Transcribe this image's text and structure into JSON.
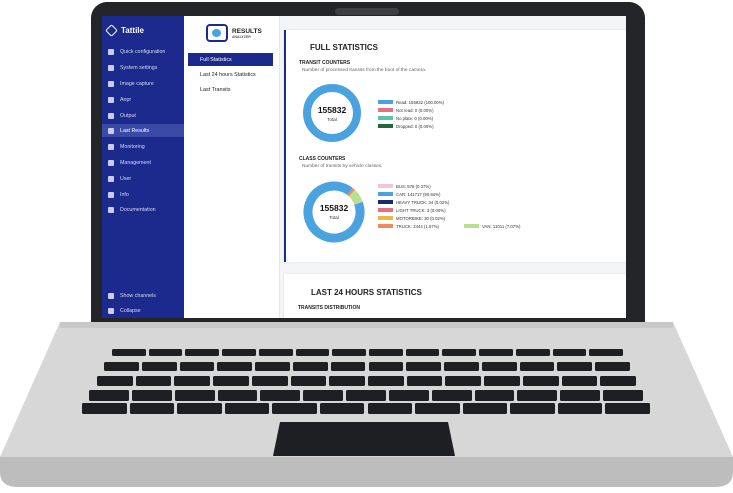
{
  "sidebar": {
    "brand": "Tattile",
    "items": [
      {
        "label": "Quick configuration",
        "icon": "wizard-icon"
      },
      {
        "label": "System settings",
        "icon": "gear-icon"
      },
      {
        "label": "Image capture",
        "icon": "image-icon"
      },
      {
        "label": "Anpr",
        "icon": "car-icon"
      },
      {
        "label": "Output",
        "icon": "output-icon"
      },
      {
        "label": "Last Results",
        "icon": "chart-icon",
        "active": true
      },
      {
        "label": "Monitoring",
        "icon": "monitor-icon"
      },
      {
        "label": "Management",
        "icon": "wrench-icon"
      },
      {
        "label": "User",
        "icon": "user-icon"
      },
      {
        "label": "Info",
        "icon": "info-icon"
      },
      {
        "label": "Documentation",
        "icon": "document-icon"
      }
    ],
    "bottom": [
      {
        "label": "Show channels",
        "icon": "eye-icon"
      },
      {
        "label": "Collapse",
        "icon": "collapse-icon"
      }
    ]
  },
  "submenu": {
    "logo_title": "RESULTS",
    "logo_subtitle": "ANALYZER",
    "items": [
      "Full Statistics",
      "Last 24 hours Statistics",
      "Last Transits"
    ]
  },
  "full_statistics": {
    "title": "FULL STATISTICS",
    "transit": {
      "heading": "TRANSIT COUNTERS",
      "description": "Number of processed transits from the boot of the camera.",
      "total_value": "155832",
      "total_label": "Total",
      "legend": [
        {
          "label": "Read: 155832 (100.00%)",
          "color": "#4aa3df",
          "fraction": 1.0
        },
        {
          "label": "Not read: 0 (0.00%)",
          "color": "#e8707d",
          "fraction": 0
        },
        {
          "label": "No plate: 0 (0.00%)",
          "color": "#5cc4a5",
          "fraction": 0
        },
        {
          "label": "Dropped: 0 (0.00%)",
          "color": "#1e6b3c",
          "fraction": 0
        }
      ]
    },
    "class": {
      "heading": "CLASS COUNTERS",
      "description": "Number of transits by vehicle classes.",
      "total_value": "155832",
      "total_label": "Total",
      "legend": [
        {
          "label": "BUS: 578 (0.37%)",
          "color": "#f2c6cf",
          "fraction": 0.0037
        },
        {
          "label": "CAR: 141717 (90.94%)",
          "color": "#4aa3df",
          "fraction": 0.9094
        },
        {
          "label": "HEAVY TRUCK: 34 (0.02%)",
          "color": "#1b2a6c",
          "fraction": 0.0002
        },
        {
          "label": "LIGHT TRUCK: 3 (0.00%)",
          "color": "#e8707d",
          "fraction": 0.0
        },
        {
          "label": "MOTORBIKE: 30 (0.02%)",
          "color": "#e8b84a",
          "fraction": 0.0002
        },
        {
          "label": "TRUCK: 2444 (1.57%)",
          "color": "#f08a5d",
          "fraction": 0.0157
        }
      ],
      "legend_right": {
        "label": "VAN: 11011 (7.07%)",
        "color": "#b9e08f",
        "fraction": 0.0707
      }
    }
  },
  "last24": {
    "title": "LAST 24 HOURS STATISTICS",
    "subheading": "TRANSITS DISTRIBUTION"
  }
}
